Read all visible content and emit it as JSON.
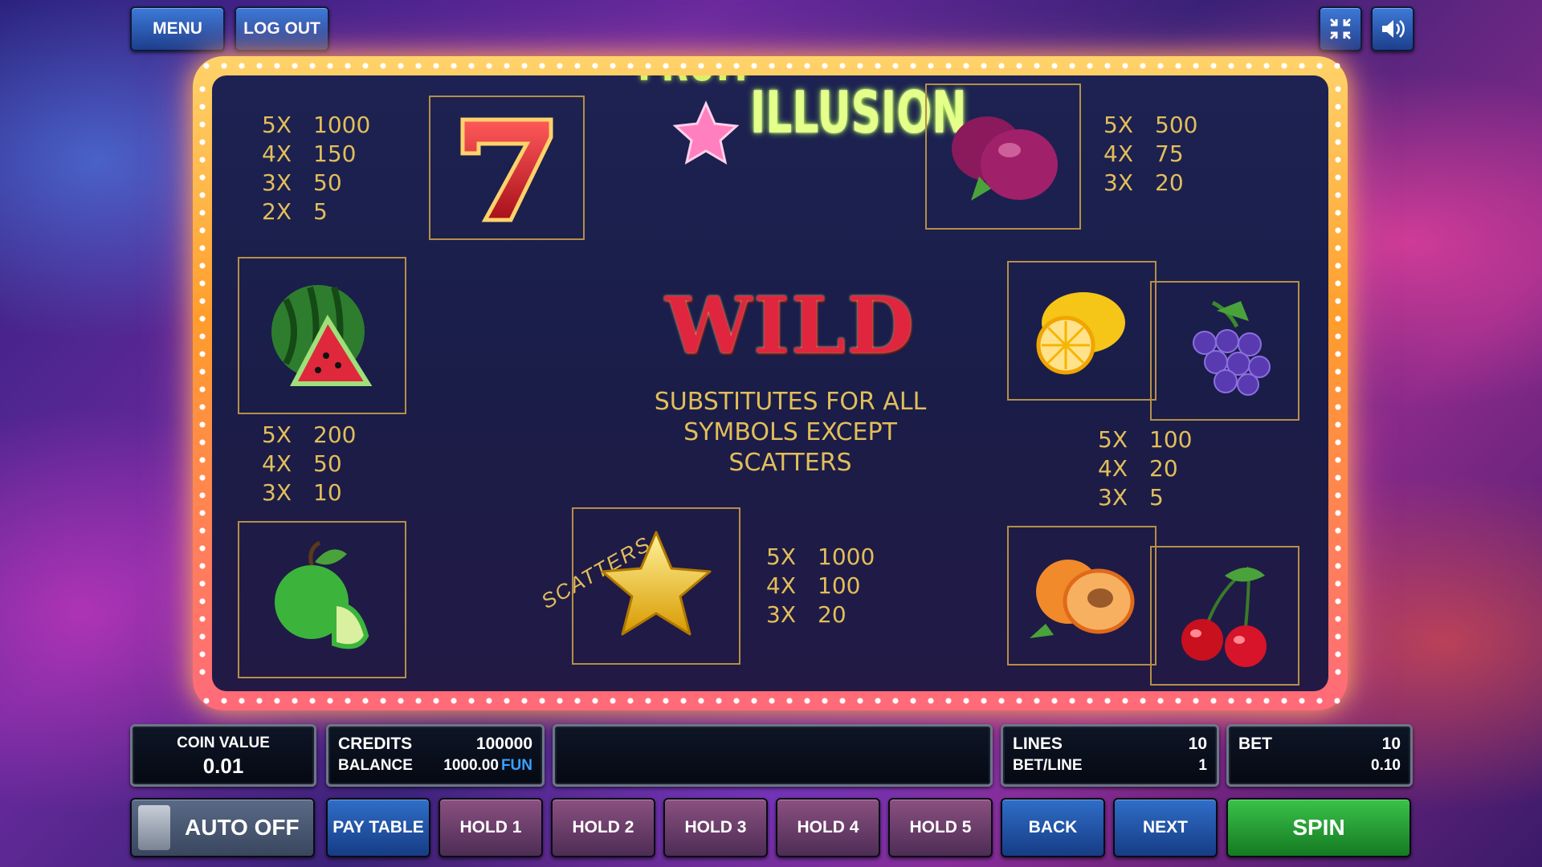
{
  "top": {
    "menu": "MENU",
    "logout": "LOG OUT",
    "fullscreen_icon": "compress-icon",
    "sound_icon": "speaker-icon"
  },
  "logo": {
    "line1": "FRUIT",
    "line2": "ILLUSION"
  },
  "paytable": {
    "seven": [
      {
        "m": "5X",
        "v": "1000"
      },
      {
        "m": "4X",
        "v": "150"
      },
      {
        "m": "3X",
        "v": "50"
      },
      {
        "m": "2X",
        "v": "5"
      }
    ],
    "plum": [
      {
        "m": "5X",
        "v": "500"
      },
      {
        "m": "4X",
        "v": "75"
      },
      {
        "m": "3X",
        "v": "20"
      }
    ],
    "watermelon": [
      {
        "m": "5X",
        "v": "200"
      },
      {
        "m": "4X",
        "v": "50"
      },
      {
        "m": "3X",
        "v": "10"
      }
    ],
    "lemon_grapes": [
      {
        "m": "5X",
        "v": "100"
      },
      {
        "m": "4X",
        "v": "20"
      },
      {
        "m": "3X",
        "v": "5"
      }
    ],
    "star": [
      {
        "m": "5X",
        "v": "1000"
      },
      {
        "m": "4X",
        "v": "100"
      },
      {
        "m": "3X",
        "v": "20"
      }
    ]
  },
  "wild": {
    "title": "WILD",
    "line1": "SUBSTITUTES FOR ALL",
    "line2": "SYMBOLS EXCEPT",
    "line3": "SCATTERS"
  },
  "scatters_label": "SCATTERS",
  "bottom": {
    "coin_value_label": "COIN VALUE",
    "coin_value": "0.01",
    "credits_label": "CREDITS",
    "credits": "100000",
    "balance_label": "BALANCE",
    "balance": "1000.00",
    "balance_unit": "FUN",
    "lines_label": "LINES",
    "lines": "10",
    "betline_label": "BET/LINE",
    "betline": "1",
    "bet_label": "BET",
    "bet": "10",
    "bet_total": "0.10"
  },
  "buttons": {
    "auto": "AUTO OFF",
    "paytable": "PAY TABLE",
    "hold1": "HOLD 1",
    "hold2": "HOLD 2",
    "hold3": "HOLD 3",
    "hold4": "HOLD 4",
    "hold5": "HOLD 5",
    "back": "BACK",
    "next": "NEXT",
    "spin": "SPIN"
  },
  "colors": {
    "accent_gold": "#e2be5a",
    "wild_red": "#e0263f",
    "spin_green": "#2bb53c",
    "button_blue": "#2f6ec8"
  }
}
